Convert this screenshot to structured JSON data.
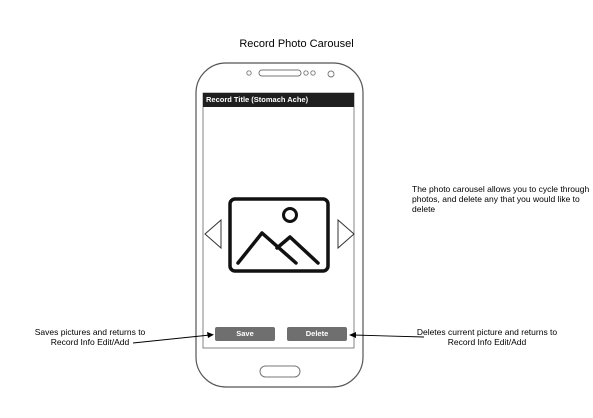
{
  "diagram": {
    "title": "Record Photo Carousel",
    "phone": {
      "record_title": "Record Title (Stomach Ache)",
      "save_label": "Save",
      "delete_label": "Delete"
    },
    "annotations": {
      "carousel_note": "The photo carousel allows you to cycle through photos, and delete any that you would like to delete",
      "save_note": "Saves pictures and returns to Record Info Edit/Add",
      "delete_note": "Deletes current picture and returns to Record Info Edit/Add"
    }
  }
}
